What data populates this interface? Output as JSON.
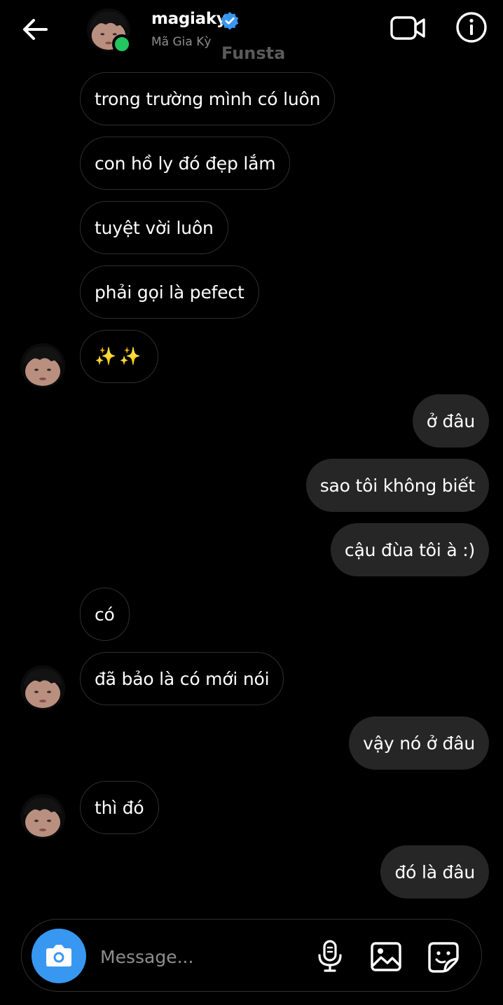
{
  "header": {
    "username": "magiaky",
    "display_name": "Mã Gia Kỳ",
    "watermark": "Funsta",
    "icons": [
      "back-arrow-icon",
      "verified-badge-icon",
      "video-call-icon",
      "info-icon"
    ],
    "online_color": "#22c55e"
  },
  "messages": [
    {
      "from": "them",
      "text": "trong trường mình có luôn"
    },
    {
      "from": "them",
      "text": "con hồ ly đó đẹp lắm"
    },
    {
      "from": "them",
      "text": "tuyệt vời luôn"
    },
    {
      "from": "them",
      "text": "phải gọi là pefect"
    },
    {
      "from": "them",
      "text": "✨✨"
    },
    {
      "from": "me",
      "text": "ở đâu"
    },
    {
      "from": "me",
      "text": "sao tôi không biết"
    },
    {
      "from": "me",
      "text": "cậu đùa tôi à :)"
    },
    {
      "from": "them",
      "text": "có"
    },
    {
      "from": "them",
      "text": "đã bảo là có mới nói"
    },
    {
      "from": "me",
      "text": "vậy nó ở đâu"
    },
    {
      "from": "them",
      "text": "thì đó"
    },
    {
      "from": "me",
      "text": "đó là đâu"
    }
  ],
  "composer": {
    "placeholder": "Message...",
    "icons": [
      "camera-icon",
      "microphone-icon",
      "gallery-icon",
      "sticker-icon"
    ],
    "camera_color": "#3897f0"
  },
  "colors": {
    "background": "#000000",
    "outgoing_bubble": "#262626",
    "incoming_border": "#2e2e2e",
    "verified": "#3897f0"
  }
}
